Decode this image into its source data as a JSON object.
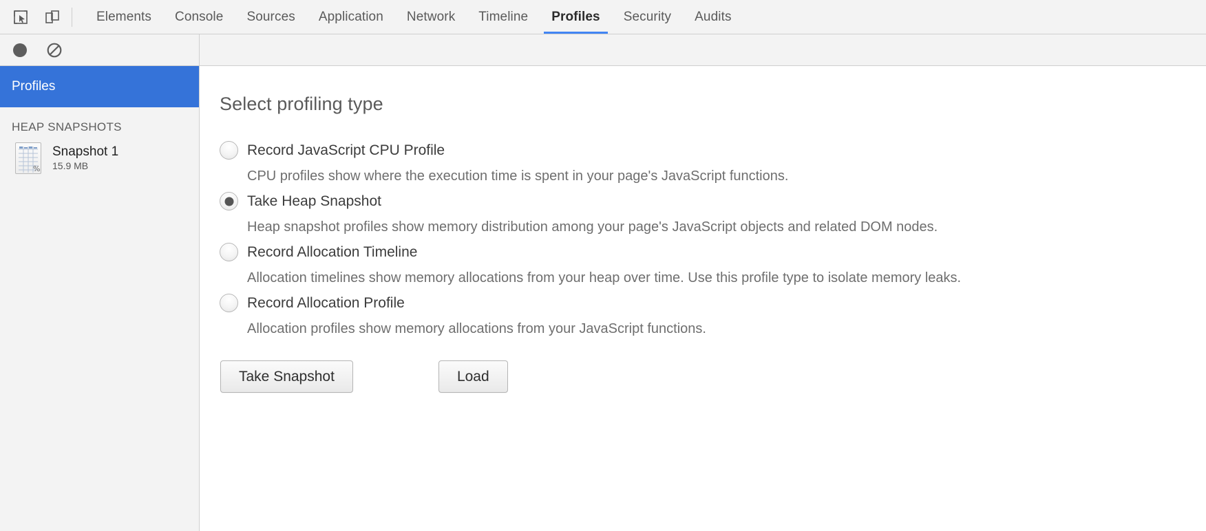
{
  "toolbar": {
    "inspect_icon": "inspect-element-icon",
    "device_icon": "toggle-device-toolbar-icon",
    "record_icon": "record-icon",
    "clear_icon": "clear-icon",
    "tabs": [
      {
        "label": "Elements",
        "active": false
      },
      {
        "label": "Console",
        "active": false
      },
      {
        "label": "Sources",
        "active": false
      },
      {
        "label": "Application",
        "active": false
      },
      {
        "label": "Network",
        "active": false
      },
      {
        "label": "Timeline",
        "active": false
      },
      {
        "label": "Profiles",
        "active": true
      },
      {
        "label": "Security",
        "active": false
      },
      {
        "label": "Audits",
        "active": false
      }
    ],
    "active_tab": "Profiles"
  },
  "sidebar": {
    "header_label": "Profiles",
    "group_title": "HEAP SNAPSHOTS",
    "items": [
      {
        "title": "Snapshot 1",
        "subtitle": "15.9 MB",
        "icon": "heap-snapshot-icon"
      }
    ]
  },
  "main": {
    "title": "Select profiling type",
    "options": [
      {
        "label": "Record JavaScript CPU Profile",
        "description": "CPU profiles show where the execution time is spent in your page's JavaScript functions.",
        "selected": false
      },
      {
        "label": "Take Heap Snapshot",
        "description": "Heap snapshot profiles show memory distribution among your page's JavaScript objects and related DOM nodes.",
        "selected": true
      },
      {
        "label": "Record Allocation Timeline",
        "description": "Allocation timelines show memory allocations from your heap over time. Use this profile type to isolate memory leaks.",
        "selected": false
      },
      {
        "label": "Record Allocation Profile",
        "description": "Allocation profiles show memory allocations from your JavaScript functions.",
        "selected": false
      }
    ],
    "take_snapshot_label": "Take Snapshot",
    "load_label": "Load"
  },
  "colors": {
    "accent_blue": "#4285f4",
    "sidebar_selected": "#3573d9",
    "toolbar_bg": "#f3f3f3",
    "border": "#cfcfcf"
  }
}
